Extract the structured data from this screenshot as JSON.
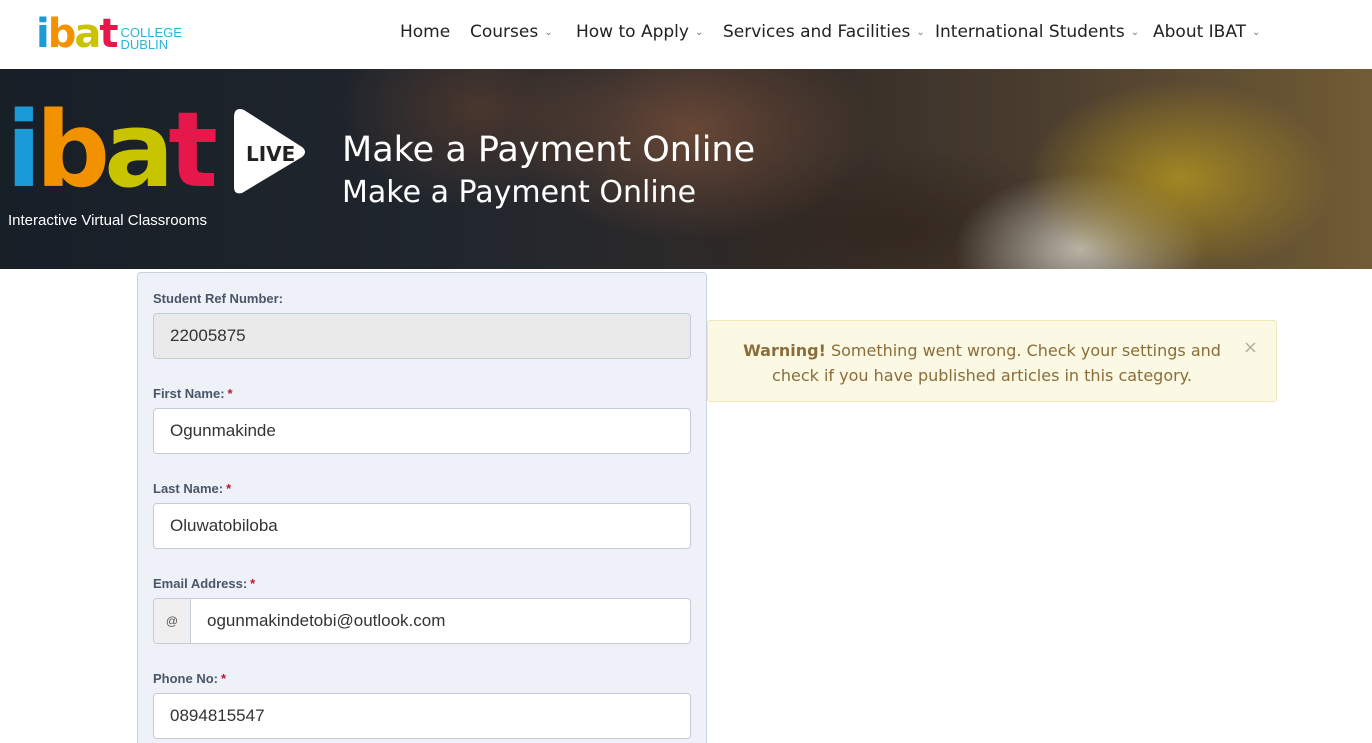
{
  "header": {
    "logo": {
      "i": "i",
      "b": "b",
      "a": "a",
      "t": "t",
      "college_line1": "COLLEGE",
      "college_line2": "DUBLIN"
    },
    "nav": [
      {
        "label": "Home",
        "dropdown": false
      },
      {
        "label": "Courses",
        "dropdown": true
      },
      {
        "label": "How to Apply",
        "dropdown": true
      },
      {
        "label": "Services and Facilities",
        "dropdown": true
      },
      {
        "label": "International Students",
        "dropdown": true
      },
      {
        "label": "About IBAT",
        "dropdown": true
      }
    ],
    "dropdown_glyph": "⌄"
  },
  "hero": {
    "logo_letters": {
      "i": "i",
      "b": "b",
      "a": "a",
      "t": "t"
    },
    "live": "LIVE",
    "subtitle": "Interactive Virtual Classrooms",
    "title": "Make a Payment Online",
    "title2": "Make a Payment Online"
  },
  "form": {
    "student_ref": {
      "label": "Student Ref Number:",
      "value": "22005875"
    },
    "first_name": {
      "label": "First Name:",
      "required": "*",
      "value": "Ogunmakinde"
    },
    "last_name": {
      "label": "Last Name:",
      "required": "*",
      "value": "Oluwatobiloba"
    },
    "email": {
      "label": "Email Address:",
      "required": "*",
      "addon": "@",
      "value": "ogunmakindetobi@outlook.com"
    },
    "phone": {
      "label": "Phone No:",
      "required": "*",
      "value": "0894815547"
    }
  },
  "alert": {
    "strong": "Warning!",
    "message": " Something went wrong. Check your settings and check if you have published articles in this category.",
    "close": "×"
  },
  "colors": {
    "brand_blue": "#1a9ad6",
    "brand_orange": "#f39200",
    "brand_yellow": "#c8c400",
    "brand_red": "#e5174b",
    "required_red": "#c0152f",
    "warning_bg": "#fbf8e3",
    "warning_text": "#8a6d3b"
  }
}
